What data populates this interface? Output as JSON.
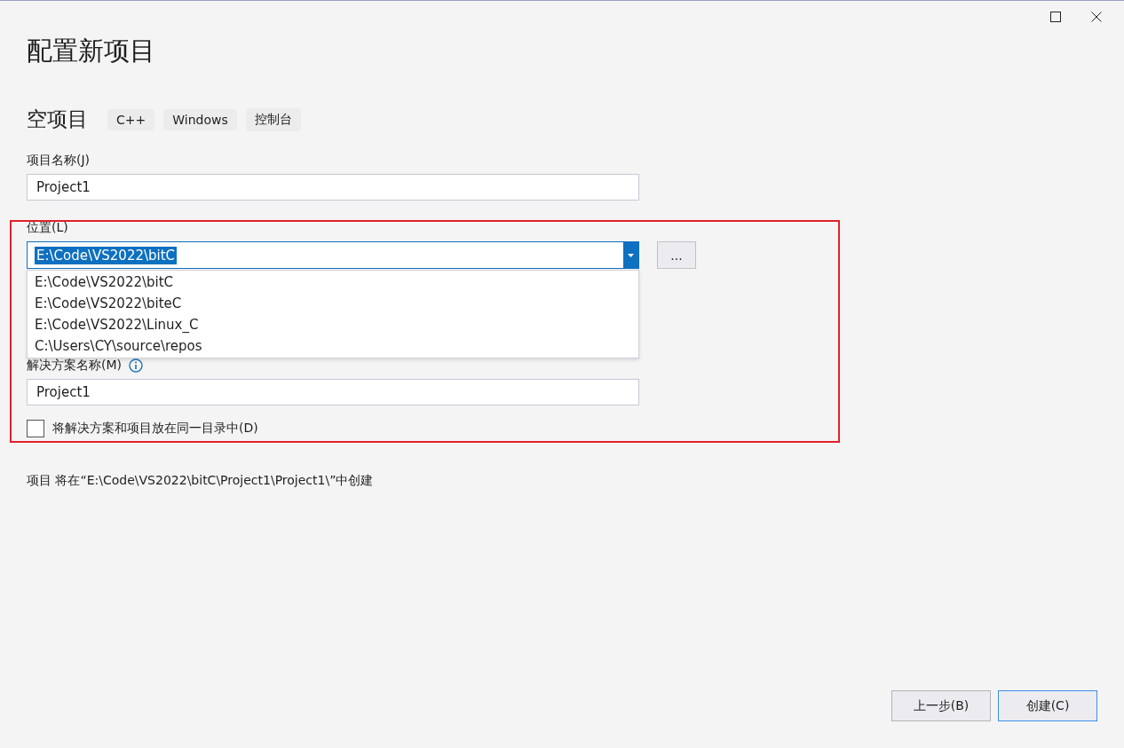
{
  "window": {
    "title": "配置新项目"
  },
  "template": {
    "name": "空项目",
    "tags": [
      "C++",
      "Windows",
      "控制台"
    ]
  },
  "project_name": {
    "label": "项目名称(J)",
    "value": "Project1"
  },
  "location": {
    "label": "位置(L)",
    "value": "E:\\Code\\VS2022\\bitC",
    "browse_label": "...",
    "expanded": true,
    "options": [
      "E:\\Code\\VS2022\\bitC",
      "E:\\Code\\VS2022\\biteC",
      "E:\\Code\\VS2022\\Linux_C",
      "C:\\Users\\CY\\source\\repos"
    ]
  },
  "solution_name": {
    "label": "解决方案名称(M)",
    "value": "Project1"
  },
  "same_directory": {
    "label": "将解决方案和项目放在同一目录中(D)",
    "checked": false
  },
  "summary": "项目 将在“E:\\Code\\VS2022\\bitC\\Project1\\Project1\\”中创建",
  "buttons": [
    {
      "label": "上一步(B)",
      "selected": false
    },
    {
      "label": "创建(C)",
      "selected": true
    }
  ]
}
